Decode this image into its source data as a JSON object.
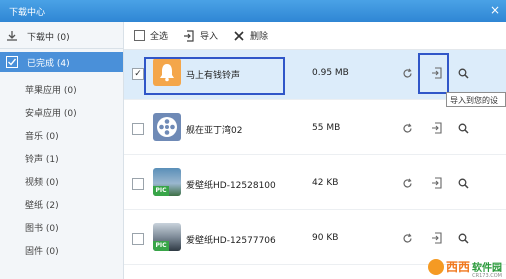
{
  "window": {
    "title": "下载中心",
    "close_glyph": "×"
  },
  "sidebar": {
    "downloading": {
      "label": "下载中 (0)",
      "icon": "download-icon"
    },
    "completed": {
      "label": "已完成 (4)",
      "icon": "check-icon"
    },
    "categories": [
      {
        "label": "苹果应用 (0)"
      },
      {
        "label": "安卓应用 (0)"
      },
      {
        "label": "音乐 (0)"
      },
      {
        "label": "铃声 (1)"
      },
      {
        "label": "视频 (0)"
      },
      {
        "label": "壁纸 (2)"
      },
      {
        "label": "图书 (0)"
      },
      {
        "label": "固件 (0)"
      }
    ]
  },
  "toolbar": {
    "select_all": "全选",
    "import": "导入",
    "delete": "删除"
  },
  "rows": [
    {
      "name": "马上有钱铃声",
      "size": "0.95 MB",
      "checked": true,
      "thumb": "bell-icon"
    },
    {
      "name": "舰在亚丁湾02",
      "size": "55 MB",
      "checked": false,
      "thumb": "film-reel-icon"
    },
    {
      "name": "爱壁纸HD-12528100",
      "size": "42 KB",
      "checked": false,
      "thumb": "wallpaper-thumbnail"
    },
    {
      "name": "爱壁纸HD-12577706",
      "size": "90 KB",
      "checked": false,
      "thumb": "wallpaper-thumbnail"
    }
  ],
  "thumb_badge": "PIC",
  "tooltip": "导入到您的设",
  "watermark": {
    "brand": "西西",
    "tag": "软件园",
    "domain": "CR173.COM"
  },
  "colors": {
    "titlebar": "#3a93dc",
    "selected_row": "#dcecfa",
    "active_sidebar": "#4a90d9",
    "highlight_box": "#3056c8"
  }
}
